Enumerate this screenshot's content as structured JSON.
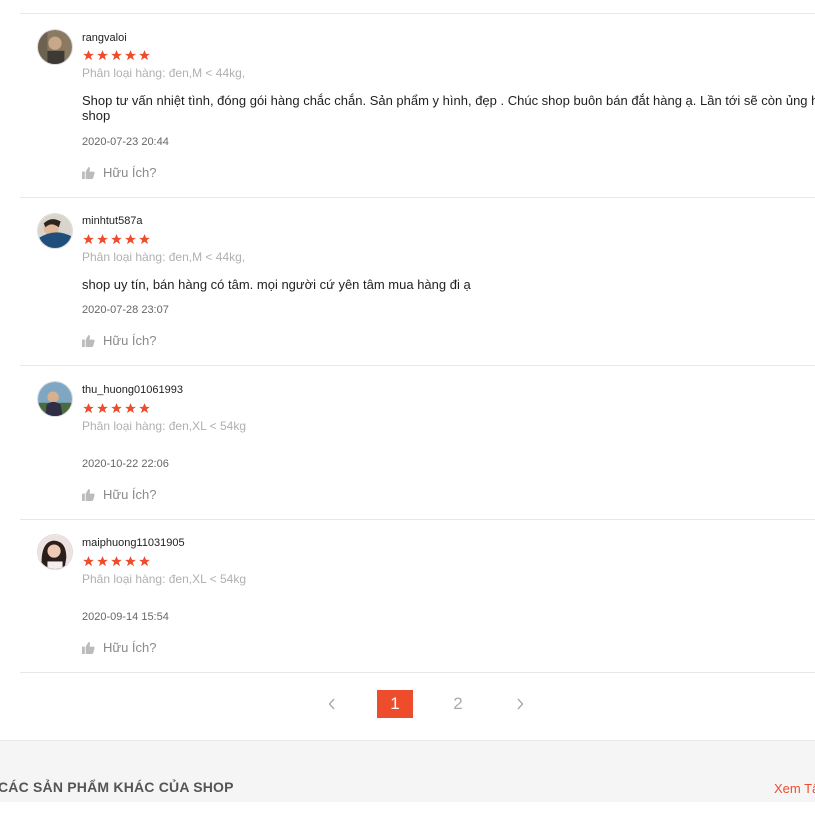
{
  "colors": {
    "accent": "#ee4d2d",
    "star": "#ee4d2d",
    "muted": "#b0b0b0"
  },
  "reviews": [
    {
      "username": "rangvaloi",
      "rating": 5,
      "variant": "Phân loại hàng: đen,M < 44kg,",
      "content_line1": "Shop tư vấn nhiệt tình, đóng gói hàng chắc chắn. Sản phẩm y hình, đẹp . Chúc shop buôn bán đắt hàng ạ. Lần tới sẽ còn ủng hộ",
      "content_line2": "shop",
      "timestamp": "2020-07-23 20:44",
      "helpful_label": "Hữu Ích?"
    },
    {
      "username": "minhtut587a",
      "rating": 5,
      "variant": "Phân loại hàng: đen,M < 44kg,",
      "content_line1": "shop uy tín, bán hàng có tâm. mọi người cứ yên tâm mua hàng đi ạ",
      "content_line2": "",
      "timestamp": "2020-07-28 23:07",
      "helpful_label": "Hữu Ích?"
    },
    {
      "username": "thu_huong01061993",
      "rating": 5,
      "variant": "Phân loại hàng: đen,XL < 54kg",
      "content_line1": "",
      "content_line2": "",
      "timestamp": "2020-10-22 22:06",
      "helpful_label": "Hữu Ích?"
    },
    {
      "username": "maiphuong11031905",
      "rating": 5,
      "variant": "Phân loại hàng: đen,XL < 54kg",
      "content_line1": "",
      "content_line2": "",
      "timestamp": "2020-09-14 15:54",
      "helpful_label": "Hữu Ích?"
    }
  ],
  "pagination": {
    "prev_icon": "chevron-left-icon",
    "pages": [
      "1",
      "2"
    ],
    "current": "1",
    "next_icon": "chevron-right-icon"
  },
  "footer": {
    "title": "CÁC SẢN PHẨM KHÁC CỦA SHOP",
    "link": "Xem Tấ"
  }
}
